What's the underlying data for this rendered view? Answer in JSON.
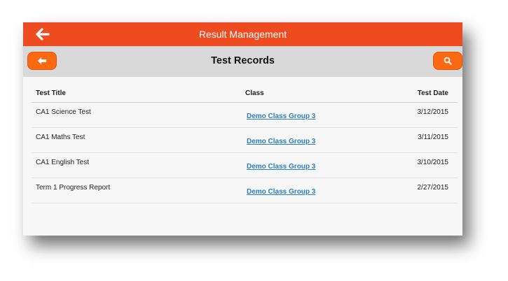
{
  "app": {
    "title": "Result Management"
  },
  "page": {
    "title": "Test Records"
  },
  "icons": {
    "back": "arrow-left-icon",
    "search": "search-icon"
  },
  "colors": {
    "topbar": "#ee4b21",
    "button": "#fb6a12",
    "subbar": "#d9d9d9",
    "link": "#2a7ec4"
  },
  "table": {
    "columns": [
      "Test Title",
      "Class",
      "Test Date"
    ],
    "rows": [
      {
        "title": "CA1 Science Test",
        "class": "Demo Class Group 3",
        "date": "3/12/2015"
      },
      {
        "title": "CA1 Maths Test",
        "class": "Demo Class Group 3",
        "date": "3/11/2015"
      },
      {
        "title": "CA1 English Test",
        "class": "Demo Class Group 3",
        "date": "3/10/2015"
      },
      {
        "title": "Term 1 Progress Report",
        "class": "Demo Class Group 3",
        "date": "2/27/2015"
      }
    ]
  }
}
